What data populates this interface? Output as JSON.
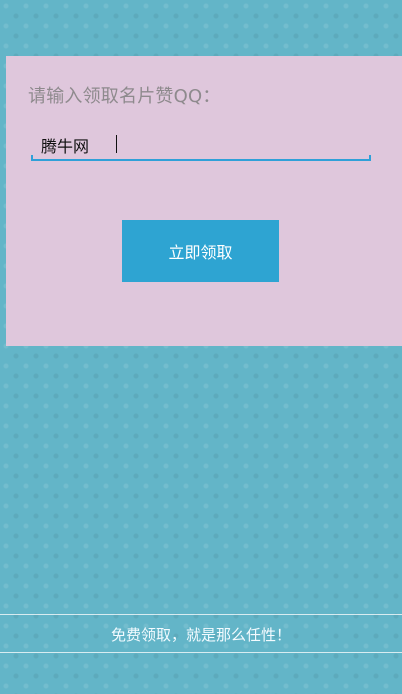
{
  "form": {
    "prompt": "请输入领取名片赞QQ：",
    "qq_value": "腾牛网",
    "submit_label": "立即领取"
  },
  "footer": {
    "text": "免费领取，就是那么任性！"
  }
}
